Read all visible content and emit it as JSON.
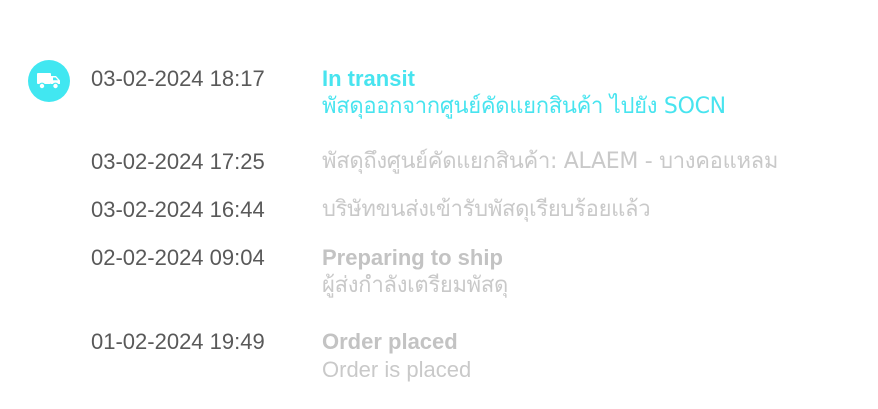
{
  "colors": {
    "accent": "#48e4ef",
    "icon_background": "#41e7f1",
    "time_text": "#595959",
    "inactive_text": "#c9c9c9",
    "inactive_title": "#c3c3c3"
  },
  "status_icon": "truck-icon",
  "events": [
    {
      "time": "03-02-2024 18:17",
      "title": "In transit",
      "description": "พัสดุออกจากศูนย์คัดแยกสินค้า ไปยัง SOCN",
      "active": true
    },
    {
      "time": "03-02-2024 17:25",
      "title": "",
      "description": "พัสดุถึงศูนย์คัดแยกสินค้า: ALAEM - บางคอแหลม",
      "active": false
    },
    {
      "time": "03-02-2024 16:44",
      "title": "",
      "description": "บริษัทขนส่งเข้ารับพัสดุเรียบร้อยแล้ว",
      "active": false
    },
    {
      "time": "02-02-2024 09:04",
      "title": "Preparing to ship",
      "description": "ผู้ส่งกำลังเตรียมพัสดุ",
      "active": false
    },
    {
      "time": "01-02-2024 19:49",
      "title": "Order placed",
      "description": "Order is placed",
      "active": false
    }
  ]
}
